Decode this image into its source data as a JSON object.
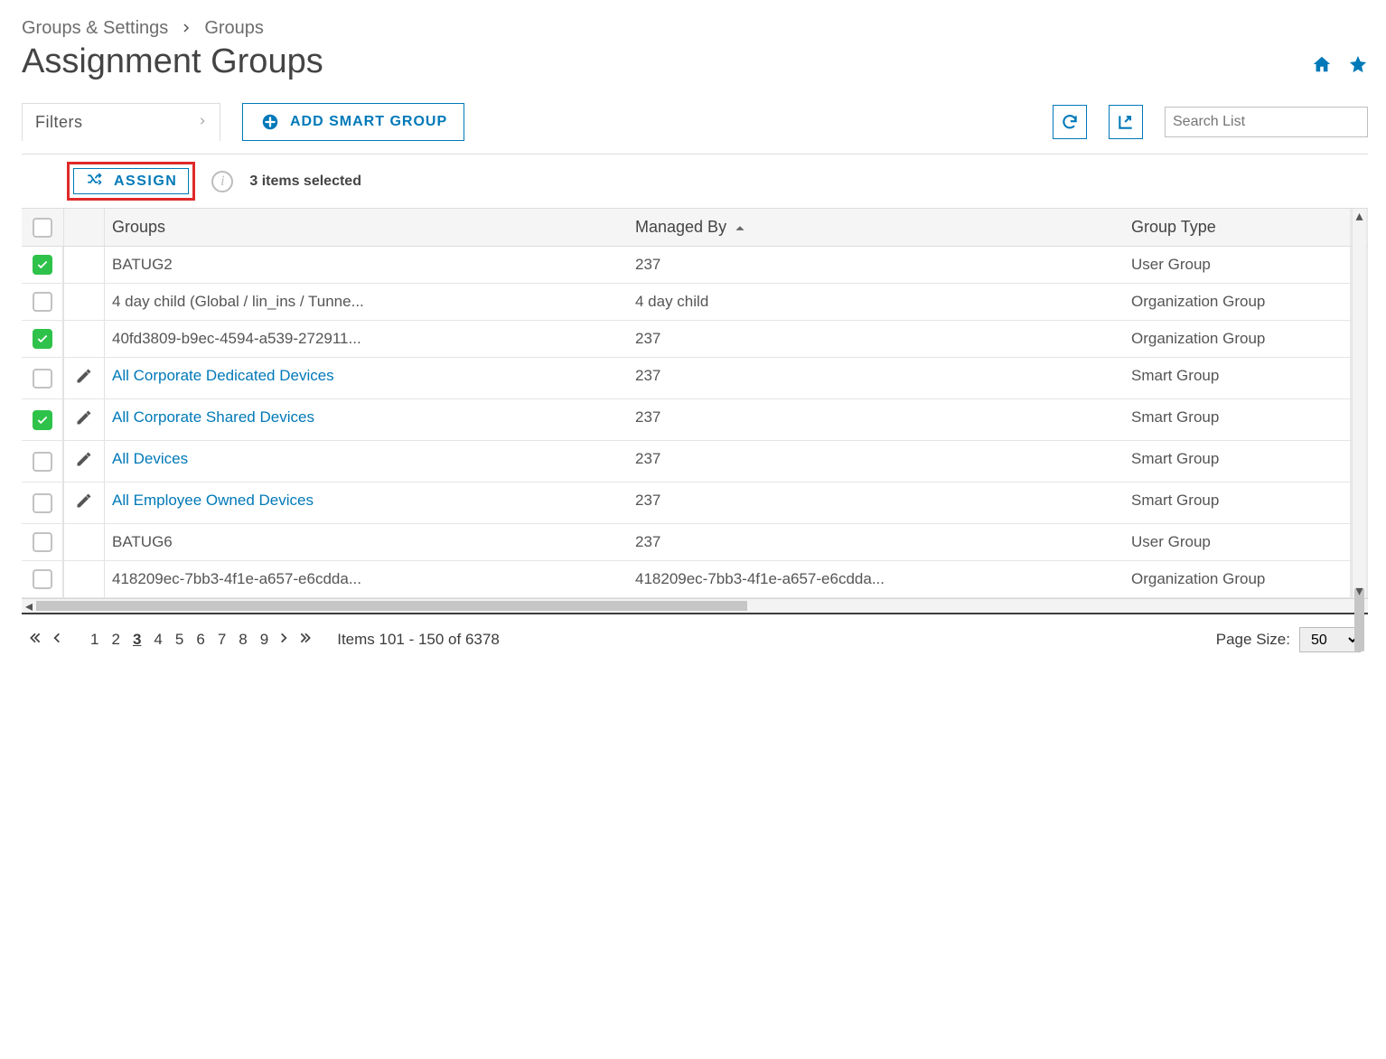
{
  "breadcrumb": {
    "root": "Groups & Settings",
    "current": "Groups"
  },
  "page": {
    "title": "Assignment Groups"
  },
  "toolbar": {
    "filters_label": "Filters",
    "add_smart_group_label": "ADD SMART GROUP",
    "search_placeholder": "Search List"
  },
  "actions": {
    "assign_label": "ASSIGN",
    "selected_text": "3 items selected"
  },
  "columns": {
    "groups": "Groups",
    "managed_by": "Managed By",
    "group_type": "Group Type",
    "sort": {
      "column": "managed_by",
      "dir": "asc"
    }
  },
  "rows": [
    {
      "checked": true,
      "editable": false,
      "link": false,
      "group": "BATUG2",
      "managed_by": "237",
      "type": "User Group"
    },
    {
      "checked": false,
      "editable": false,
      "link": false,
      "group": "4 day child (Global / lin_ins / Tunne...",
      "managed_by": "4 day child",
      "type": "Organization Group"
    },
    {
      "checked": true,
      "editable": false,
      "link": false,
      "group": "40fd3809-b9ec-4594-a539-272911...",
      "managed_by": "237",
      "type": "Organization Group"
    },
    {
      "checked": false,
      "editable": true,
      "link": true,
      "group": "All Corporate Dedicated Devices",
      "managed_by": "237",
      "type": "Smart Group"
    },
    {
      "checked": true,
      "editable": true,
      "link": true,
      "group": "All Corporate Shared Devices",
      "managed_by": "237",
      "type": "Smart Group"
    },
    {
      "checked": false,
      "editable": true,
      "link": true,
      "group": "All Devices",
      "managed_by": "237",
      "type": "Smart Group"
    },
    {
      "checked": false,
      "editable": true,
      "link": true,
      "group": "All Employee Owned Devices",
      "managed_by": "237",
      "type": "Smart Group"
    },
    {
      "checked": false,
      "editable": false,
      "link": false,
      "group": "BATUG6",
      "managed_by": "237",
      "type": "User Group"
    },
    {
      "checked": false,
      "editable": false,
      "link": false,
      "group": "418209ec-7bb3-4f1e-a657-e6cdda...",
      "managed_by": "418209ec-7bb3-4f1e-a657-e6cdda...",
      "type": "Organization Group"
    }
  ],
  "pagination": {
    "pages": [
      "1",
      "2",
      "3",
      "4",
      "5",
      "6",
      "7",
      "8",
      "9"
    ],
    "current": "3",
    "range_text": "Items 101 - 150 of 6378",
    "page_size_label": "Page Size:",
    "page_size_value": "50"
  }
}
